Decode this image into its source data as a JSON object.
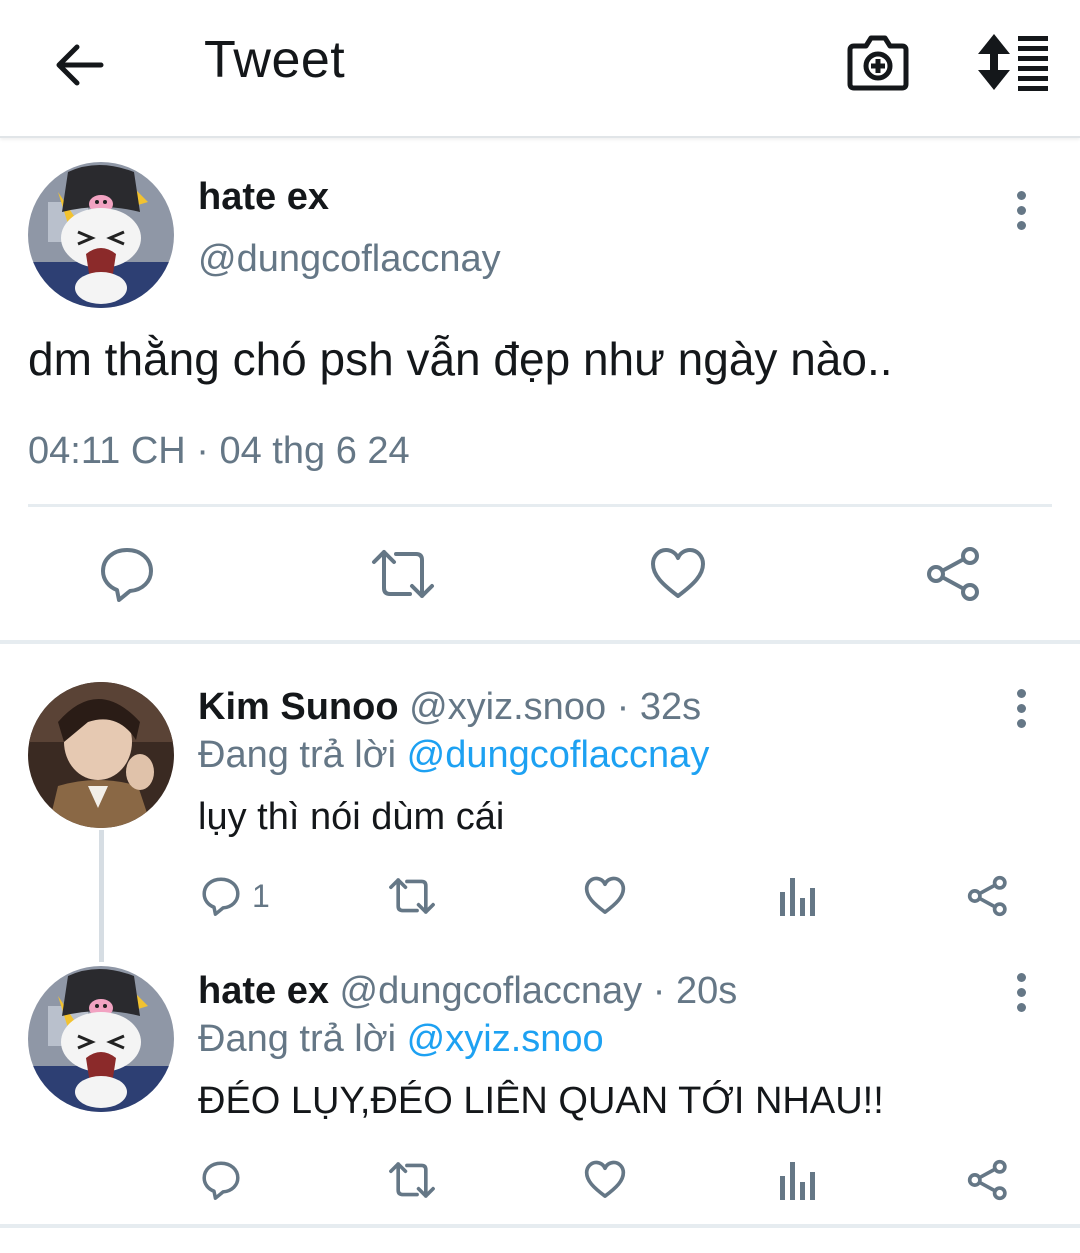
{
  "header": {
    "title": "Tweet",
    "back_icon": "arrow-left-icon",
    "camera_icon": "camera-add-icon",
    "sort_icon": "sort-list-icon"
  },
  "main_tweet": {
    "display_name": "hate ex",
    "handle": "@dungcoflaccnay",
    "text": "dm thằng chó psh vẫn đẹp như ngày nào..",
    "timestamp": "04:11 CH · 04 thg 6 24",
    "actions": [
      "reply-icon",
      "retweet-icon",
      "like-icon",
      "share-icon"
    ]
  },
  "replies": [
    {
      "display_name": "Kim Sunoo",
      "meta": "@xyiz.snoo · 32s",
      "context_prefix": "Đang trả lời",
      "context_mention": "@dungcoflaccnay",
      "text": "lụy thì nói dùm cái",
      "reply_count": "1"
    },
    {
      "display_name": "hate ex",
      "meta": "@dungcoflaccnay · 20s",
      "context_prefix": "Đang trả lời",
      "context_mention": "@xyiz.snoo",
      "text": "ĐÉO LỤY,ĐÉO LIÊN QUAN TỚI NHAU!!",
      "reply_count": ""
    }
  ],
  "colors": {
    "text_primary": "#14171a",
    "text_secondary": "#657786",
    "link": "#1da1f2",
    "divider": "#e6ecf0"
  }
}
